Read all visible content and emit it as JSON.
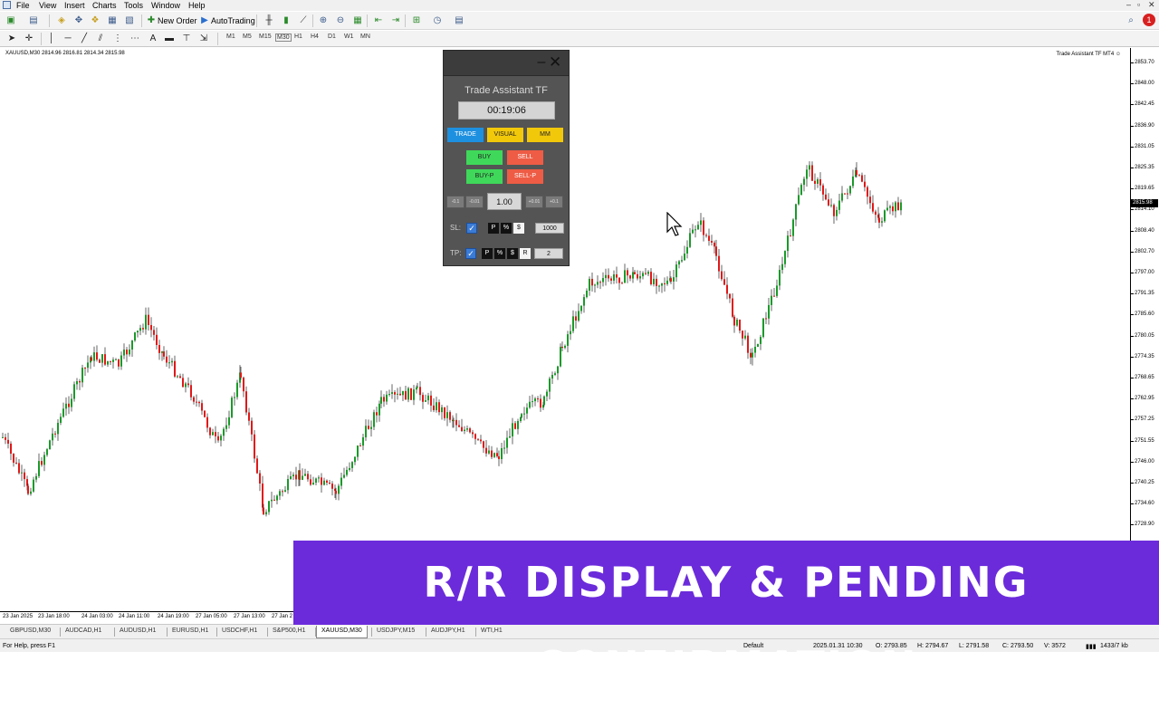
{
  "menubar": {
    "items": [
      "File",
      "View",
      "Insert",
      "Charts",
      "Tools",
      "Window",
      "Help"
    ],
    "alert_count": "1"
  },
  "toolbar": {
    "new_order": "New Order",
    "auto_trading": "AutoTrading",
    "timeframes": [
      "M1",
      "M5",
      "M15",
      "M30",
      "H1",
      "H4",
      "D1",
      "W1",
      "MN"
    ]
  },
  "chart": {
    "info": "XAUUSD,M30  2814.96 2816.81 2814.34 2815.98",
    "ea_label": "Trade Assistant TF MT4",
    "current_price": "2815.98",
    "price_labels": [
      "2853.70",
      "2848.00",
      "2842.45",
      "2836.90",
      "2831.05",
      "2825.35",
      "2819.65",
      "2814.10",
      "2808.40",
      "2802.70",
      "2797.00",
      "2791.35",
      "2785.60",
      "2780.05",
      "2774.35",
      "2768.65",
      "2762.95",
      "2757.25",
      "2751.55",
      "2746.00",
      "2740.25",
      "2734.60",
      "2728.90"
    ],
    "time_labels": [
      "23 Jan 2025",
      "23 Jan 18:00",
      "24 Jan 03:00",
      "24 Jan 11:00",
      "24 Jan 19:00",
      "27 Jan 05:00",
      "27 Jan 13:00",
      "27 Jan 2"
    ]
  },
  "panel": {
    "title": "Trade Assistant TF",
    "timer": "00:19:06",
    "tabs": {
      "trade": "TRADE",
      "visual": "VISUAL",
      "mm": "MM"
    },
    "buy": "BUY",
    "sell": "SELL",
    "buy_pending": "BUY-P",
    "sell_pending": "SELL-P",
    "steps": {
      "minus_big": "-0.1",
      "minus_small": "-0.01",
      "plus_small": "+0.01",
      "plus_big": "+0.1"
    },
    "lot": "1.00",
    "sl": {
      "label": "SL:",
      "modes": [
        "P",
        "%",
        "$"
      ],
      "value": "1000"
    },
    "tp": {
      "label": "TP:",
      "modes": [
        "P",
        "%",
        "$",
        "R"
      ],
      "value": "2"
    }
  },
  "tabs": [
    "GBPUSD,M30",
    "AUDCAD,H1",
    "AUDUSD,H1",
    "EURUSD,H1",
    "USDCHF,H1",
    "S&P500,H1",
    "XAUUSD,M30",
    "USDJPY,M15",
    "AUDJPY,H1",
    "WTI,H1"
  ],
  "status": {
    "help": "For Help, press F1",
    "profile": "Default",
    "datetime": "2025.01.31 10:30",
    "open": "O: 2793.85",
    "high": "H: 2794.67",
    "low": "L: 2791.58",
    "close": "C: 2793.50",
    "volume": "V: 3572",
    "traffic": "1433/7 kb"
  },
  "banner": "R/R DISPLAY & PENDING CONFIRMATION",
  "colors": {
    "bull": "#1a9a2a",
    "bear": "#e01818",
    "banner": "#6b2bdb",
    "trade_tab": "#1e90e0",
    "buy": "#3fd85a",
    "sell": "#ee5c45"
  }
}
